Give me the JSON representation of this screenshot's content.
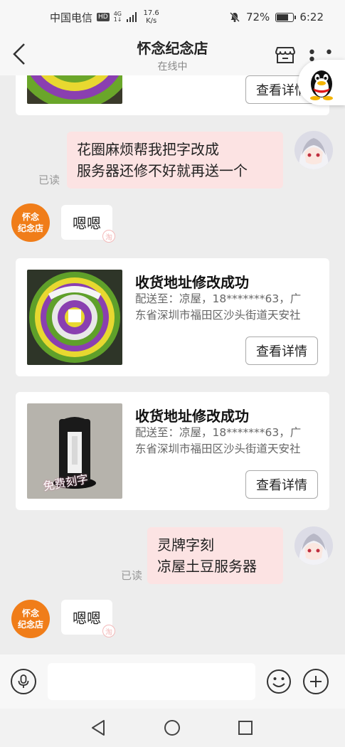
{
  "statusbar": {
    "carrier": "中国电信",
    "hd": "HD",
    "network_top": "4G",
    "network_bottom": "1↓",
    "speed_value": "17.6",
    "speed_unit": "K/s",
    "battery_text": "72%",
    "battery_level": 0.72,
    "time": "6:22"
  },
  "header": {
    "title": "怀念纪念店",
    "subtitle": "在线中",
    "back_icon": "chevron-left-icon",
    "store_icon": "store-icon",
    "more_icon": "more-dots-icon"
  },
  "floating": {
    "icon": "qq-penguin-icon"
  },
  "shop": {
    "avatar_line1": "怀念",
    "avatar_line2": "纪念店",
    "brand_color": "#f07d19"
  },
  "messages": {
    "top_card_button": "查看详情",
    "user_msg_1_line1": "花圈麻烦帮我把字改成",
    "user_msg_1_line2": "服务器还修不好就再送一个",
    "read_1": "已读",
    "shop_reply_1": "嗯嗯",
    "card_1": {
      "title": "收货地址修改成功",
      "address_line1": "配送至：凉屋，18*******63，广",
      "address_line2": "东省深圳市福田区沙头街道天安社",
      "button": "查看详情"
    },
    "card_2": {
      "title": "收货地址修改成功",
      "address_line1": "配送至：凉屋，18*******63，广",
      "address_line2": "东省深圳市福田区沙头街道天安社",
      "button": "查看详情",
      "image_overlay": "免费刻字"
    },
    "user_msg_2_line1": "灵牌字刻",
    "user_msg_2_line2": "凉屋土豆服务器",
    "read_2": "已读",
    "shop_reply_2": "嗯嗯",
    "mark": "淘"
  },
  "inputbar": {
    "placeholder": "",
    "mic_icon": "microphone-icon",
    "emoji_icon": "emoji-icon",
    "plus_icon": "plus-icon"
  },
  "navbar": {
    "back": "nav-back-icon",
    "home": "nav-home-icon",
    "recents": "nav-recents-icon"
  }
}
